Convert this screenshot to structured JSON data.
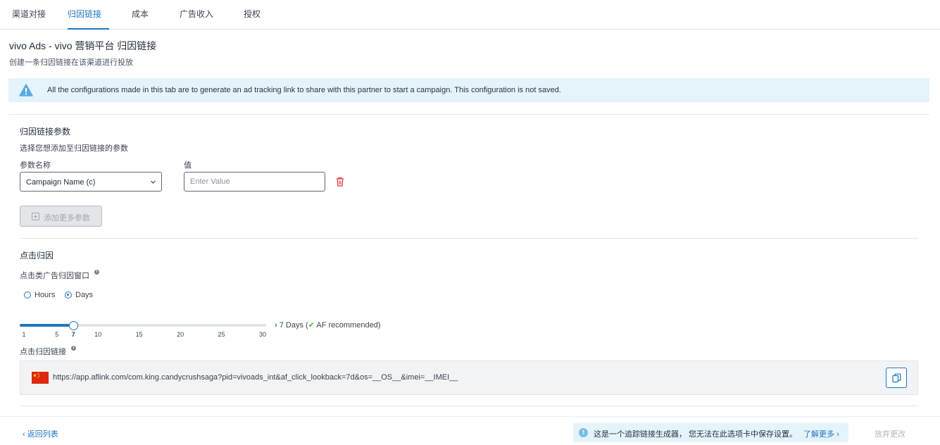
{
  "tabs": [
    {
      "label": "渠道对接",
      "active": false
    },
    {
      "label": "归因链接",
      "active": true
    },
    {
      "label": "成本",
      "active": false
    },
    {
      "label": "广告收入",
      "active": false
    },
    {
      "label": "授权",
      "active": false
    }
  ],
  "header": {
    "title": "vivo Ads - vivo 营销平台 归因链接",
    "subtitle": "创建一条归因链接在该渠道进行投放"
  },
  "banner": {
    "icon": "warning-icon",
    "text": "All the configurations made in this tab are to generate an ad tracking link to share with this partner to start a campaign. This configuration is not saved."
  },
  "params_section": {
    "title": "归因链接参数",
    "help": "选择您想添加至归因链接的参数",
    "name_label": "参数名称",
    "value_label": "值",
    "param_name": "Campaign Name (c)",
    "value_placeholder": "Enter Value",
    "value": "",
    "add_button_label": "添加更多参数"
  },
  "click_section": {
    "title": "点击归因",
    "window_label": "点击类广告归因窗口",
    "info_glyph": "i",
    "unit_options": [
      {
        "label": "Hours",
        "checked": false
      },
      {
        "label": "Days",
        "checked": true
      }
    ],
    "slider": {
      "min": 1,
      "max": 30,
      "value": 7,
      "ticks": [
        "1",
        "5",
        "7",
        "10",
        "15",
        "20",
        "25",
        "30"
      ]
    },
    "readout_value": "7 Days (",
    "readout_recommended": "AF recommended)",
    "link_label": "点击归因链接",
    "link_url": "https://app.aflink.com/com.king.candycrushsaga?pid=vivoads_int&af_click_lookback=7d&os=__OS__&imei=__IMEI__",
    "flag_icon": "china-flag-icon",
    "copy_icon": "copy-icon"
  },
  "footer": {
    "back_label": "返回列表",
    "note_glyph": "!",
    "note_text": "这是一个追踪链接生成器， 您无法在此选项卡中保存设置。",
    "note_link": "了解更多",
    "discard_label": "放弃更改"
  },
  "colors": {
    "accent": "#1f76bd",
    "banner_bg": "#e5f3fa",
    "delete": "#d9363e",
    "recommended": "#5bb543"
  }
}
